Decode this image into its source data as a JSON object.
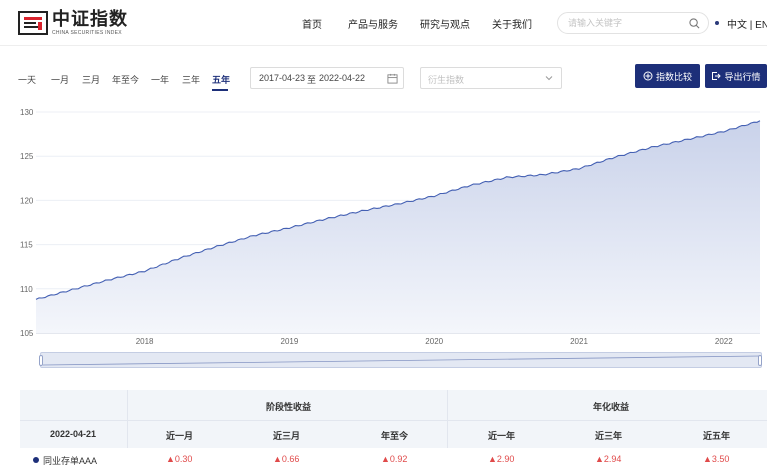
{
  "header": {
    "logo_cn": "中证指数",
    "logo_en": "CHINA SECURITIES INDEX",
    "nav": [
      "首页",
      "产品与服务",
      "研究与观点",
      "关于我们"
    ],
    "search_placeholder": "请输入关键字",
    "lang": "中文 | EN"
  },
  "toolbar": {
    "periods": [
      "一天",
      "一月",
      "三月",
      "年至今",
      "一年",
      "三年",
      "五年"
    ],
    "active_period": "五年",
    "date_start": "2017-04-23",
    "date_sep": "至",
    "date_end": "2022-04-22",
    "index_select_placeholder": "衍生指数",
    "compare_button": "指数比较",
    "export_button": "导出行情"
  },
  "chart_data": {
    "type": "area",
    "x_ticks": [
      "2018",
      "2019",
      "2020",
      "2021",
      "2022"
    ],
    "y_ticks": [
      105,
      110,
      115,
      120,
      125,
      130
    ],
    "ylim": [
      105,
      130
    ],
    "x": [
      "2017-04",
      "2017-07",
      "2017-10",
      "2018-01",
      "2018-04",
      "2018-07",
      "2018-10",
      "2019-01",
      "2019-04",
      "2019-07",
      "2019-10",
      "2020-01",
      "2020-04",
      "2020-07",
      "2020-10",
      "2021-01",
      "2021-04",
      "2021-07",
      "2021-10",
      "2022-01",
      "2022-04"
    ],
    "values": [
      108.8,
      109.9,
      111.0,
      112.0,
      113.5,
      114.8,
      116.0,
      116.9,
      117.9,
      118.8,
      119.6,
      120.5,
      121.7,
      122.6,
      122.9,
      123.6,
      124.9,
      126.0,
      126.9,
      127.8,
      129.0
    ],
    "colors": {
      "line": "#4460b3",
      "fill_top": "#c9d2ea",
      "fill_bottom": "#f4f6fb"
    }
  },
  "table": {
    "date": "2022-04-21",
    "group_periodic": "阶段性收益",
    "group_annual": "年化收益",
    "columns": [
      "近一月",
      "近三月",
      "年至今",
      "近一年",
      "近三年",
      "近五年"
    ],
    "row": {
      "name": "同业存单AAA",
      "values": [
        "0.30",
        "0.66",
        "0.92",
        "2.90",
        "2.94",
        "3.50"
      ]
    }
  }
}
